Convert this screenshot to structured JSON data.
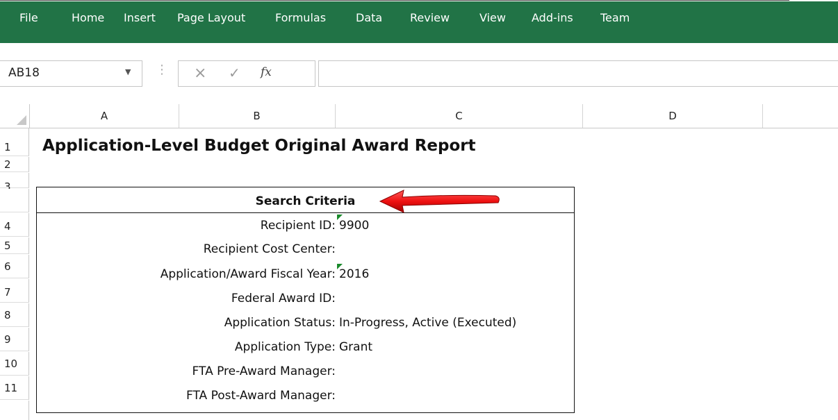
{
  "ribbon": {
    "tabs": [
      "File",
      "Home",
      "Insert",
      "Page Layout",
      "Formulas",
      "Data",
      "Review",
      "View",
      "Add-ins",
      "Team"
    ],
    "color": "#217346"
  },
  "formula_bar": {
    "name_box": "AB18",
    "cancel_icon": "×",
    "enter_icon": "✓",
    "fx_label": "fx",
    "formula": ""
  },
  "columns": [
    "A",
    "B",
    "C",
    "D"
  ],
  "row_numbers": [
    "1",
    "2",
    "3",
    "4",
    "5",
    "6",
    "7",
    "8",
    "9",
    "10",
    "11"
  ],
  "sheet": {
    "title": "Application-Level Budget Original Award Report",
    "search_criteria_header": "Search Criteria",
    "criteria": [
      {
        "label": "Recipient ID:",
        "value": "9900",
        "flag": true
      },
      {
        "label": "Recipient Cost Center:",
        "value": "",
        "flag": false
      },
      {
        "label": "Application/Award Fiscal Year:",
        "value": "2016",
        "flag": true
      },
      {
        "label": "Federal Award ID:",
        "value": "",
        "flag": false
      },
      {
        "label": "Application Status:",
        "value": "In-Progress, Active (Executed)",
        "flag": false
      },
      {
        "label": "Application Type:",
        "value": "Grant",
        "flag": false
      },
      {
        "label": "FTA Pre-Award Manager:",
        "value": "",
        "flag": false
      },
      {
        "label": "FTA Post-Award Manager:",
        "value": "",
        "flag": false
      }
    ]
  }
}
